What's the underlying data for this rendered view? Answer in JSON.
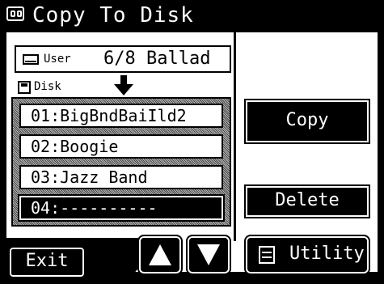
{
  "title": "Copy To Disk",
  "source": {
    "label": "User",
    "song": "6/8 Ballad"
  },
  "destination": {
    "label": "Disk"
  },
  "disk_list": [
    {
      "label": "01:BigBndBaiIld2",
      "selected": false
    },
    {
      "label": "02:Boogie",
      "selected": false
    },
    {
      "label": "03:Jazz Band",
      "selected": false
    },
    {
      "label": "04:----------",
      "selected": true
    }
  ],
  "buttons": {
    "copy": "Copy",
    "delete": "Delete",
    "exit": "Exit",
    "utility": "Utility"
  },
  "icons": {
    "title": "book-icon",
    "user": "keyboard-icon",
    "disk": "floppy-disk-icon",
    "arrow": "arrow-down-icon",
    "scroll_up": "triangle-up-icon",
    "scroll_down": "triangle-down-icon",
    "utility": "utility-icon"
  }
}
